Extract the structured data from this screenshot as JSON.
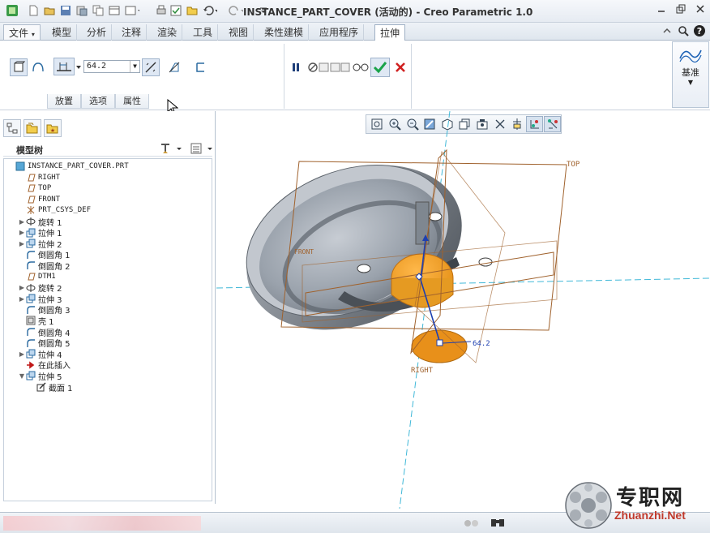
{
  "window": {
    "title": "INSTANCE_PART_COVER (活动的) - Creo Parametric 1.0"
  },
  "quick_access": {
    "icons": [
      "app-logo-icon",
      "new-icon",
      "open-icon",
      "save-icon",
      "regenerate-icon",
      "copy-icon",
      "windows-icon",
      "dropdown-icon",
      "print-icon",
      "verify-icon",
      "folder-icon",
      "undo-icon",
      "redo-icon",
      "customize-icon"
    ]
  },
  "menu_tabs": {
    "file": "文件",
    "items": [
      "模型",
      "分析",
      "注释",
      "渲染",
      "工具",
      "视图",
      "柔性建模",
      "应用程序"
    ],
    "active": "拉伸"
  },
  "ribbon": {
    "depth_value": "64.2",
    "subtabs": [
      "放置",
      "选项",
      "属性"
    ],
    "datum_label": "基准"
  },
  "model_tree": {
    "header": "模型树",
    "items": [
      {
        "label": "INSTANCE_PART_COVER.PRT",
        "icon": "part-icon",
        "expand": "",
        "indent": 0
      },
      {
        "label": "RIGHT",
        "icon": "datum-plane-icon",
        "expand": "",
        "indent": 1
      },
      {
        "label": "TOP",
        "icon": "datum-plane-icon",
        "expand": "",
        "indent": 1
      },
      {
        "label": "FRONT",
        "icon": "datum-plane-icon",
        "expand": "",
        "indent": 1
      },
      {
        "label": "PRT_CSYS_DEF",
        "icon": "csys-icon",
        "expand": "",
        "indent": 1
      },
      {
        "label": "旋转 1",
        "icon": "revolve-icon",
        "expand": "▶",
        "indent": 1
      },
      {
        "label": "拉伸 1",
        "icon": "extrude-icon",
        "expand": "▶",
        "indent": 1
      },
      {
        "label": "拉伸 2",
        "icon": "extrude-icon",
        "expand": "▶",
        "indent": 1
      },
      {
        "label": "倒圆角 1",
        "icon": "round-icon",
        "expand": "",
        "indent": 1
      },
      {
        "label": "倒圆角 2",
        "icon": "round-icon",
        "expand": "",
        "indent": 1
      },
      {
        "label": "DTM1",
        "icon": "datum-plane-icon",
        "expand": "",
        "indent": 1
      },
      {
        "label": "旋转 2",
        "icon": "revolve-icon",
        "expand": "▶",
        "indent": 1
      },
      {
        "label": "拉伸 3",
        "icon": "extrude-icon",
        "expand": "▶",
        "indent": 1
      },
      {
        "label": "倒圆角 3",
        "icon": "round-icon",
        "expand": "",
        "indent": 1
      },
      {
        "label": "壳 1",
        "icon": "shell-icon",
        "expand": "",
        "indent": 1
      },
      {
        "label": "倒圆角 4",
        "icon": "round-icon",
        "expand": "",
        "indent": 1
      },
      {
        "label": "倒圆角 5",
        "icon": "round-icon",
        "expand": "",
        "indent": 1
      },
      {
        "label": "拉伸 4",
        "icon": "extrude-icon",
        "expand": "▶",
        "indent": 1
      },
      {
        "label": "在此插入",
        "icon": "insert-arrow-icon",
        "expand": "",
        "indent": 1
      },
      {
        "label": "拉伸 5",
        "icon": "extrude-icon",
        "expand": "▼",
        "indent": 1
      },
      {
        "label": "截面 1",
        "icon": "sketch-icon",
        "expand": "",
        "indent": 2
      }
    ]
  },
  "graphics": {
    "plane_labels": {
      "top": "TOP",
      "right": "RIGHT",
      "front": "FRONT"
    },
    "dimension": "64.2"
  },
  "watermark": {
    "cn": "专职网",
    "url": "Zhuanzhi.Net"
  },
  "colors": {
    "accent": "#f0a020",
    "plane": "#a0622d",
    "axis": "#40b8d8",
    "check": "#1aa34a",
    "cancel": "#d02020"
  }
}
